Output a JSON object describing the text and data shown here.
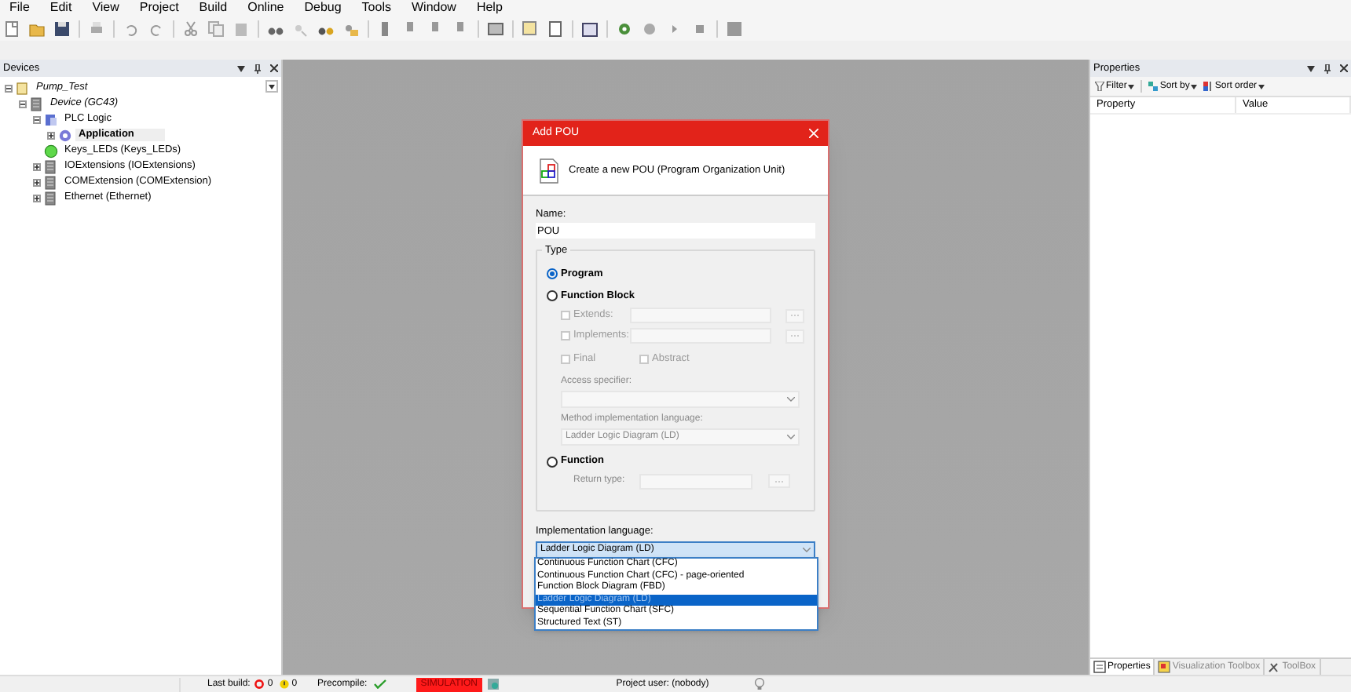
{
  "menu": [
    "File",
    "Edit",
    "View",
    "Project",
    "Build",
    "Online",
    "Debug",
    "Tools",
    "Window",
    "Help"
  ],
  "devices": {
    "title": "Devices",
    "tree": [
      {
        "label": "Pump_Test",
        "kind": "project",
        "italic": true,
        "expanded": true,
        "selected": false,
        "children": [
          {
            "label": "Device (GC43)",
            "kind": "device",
            "italic": true,
            "expanded": true,
            "selected": false,
            "children": [
              {
                "label": "PLC Logic",
                "kind": "plc",
                "italic": false,
                "expanded": true,
                "selected": false,
                "children": [
                  {
                    "label": "Application",
                    "kind": "app",
                    "italic": false,
                    "expanded": false,
                    "selected": true
                  }
                ]
              },
              {
                "label": "Keys_LEDs (Keys_LEDs)",
                "kind": "led",
                "italic": false,
                "selected": false
              },
              {
                "label": "IOExtensions (IOExtensions)",
                "kind": "device",
                "italic": false,
                "expanded": false,
                "selected": false
              },
              {
                "label": "COMExtension (COMExtension)",
                "kind": "device",
                "italic": false,
                "expanded": false,
                "selected": false
              },
              {
                "label": "Ethernet (Ethernet)",
                "kind": "device",
                "italic": false,
                "expanded": false,
                "selected": false
              }
            ]
          }
        ]
      }
    ]
  },
  "dialog": {
    "title": "Add POU",
    "header": "Create a new POU (Program Organization Unit)",
    "name_label": "Name:",
    "name_value": "POU",
    "type_label": "Type",
    "program": {
      "label": "Program",
      "selected": true
    },
    "function_block": {
      "label": "Function Block",
      "selected": false,
      "extends": {
        "label": "Extends:",
        "checked": false,
        "disabled": true
      },
      "implements": {
        "label": "Implements:",
        "checked": false,
        "disabled": true
      },
      "final": {
        "label": "Final",
        "checked": false,
        "disabled": true
      },
      "abstract": {
        "label": "Abstract",
        "checked": false,
        "disabled": true
      },
      "access_label": "Access specifier:",
      "method_label": "Method implementation language:",
      "method_value": "Ladder Logic Diagram (LD)"
    },
    "function": {
      "label": "Function",
      "selected": false,
      "return_label": "Return type:"
    },
    "impl_label": "Implementation language:",
    "impl_value": "Ladder Logic Diagram (LD)",
    "impl_options": [
      {
        "label": "Continuous Function Chart (CFC)",
        "selected": false
      },
      {
        "label": "Continuous Function Chart (CFC) - page-oriented",
        "selected": false
      },
      {
        "label": "Function Block Diagram (FBD)",
        "selected": false
      },
      {
        "label": "Ladder Logic Diagram (LD)",
        "selected": true
      },
      {
        "label": "Sequential Function Chart (SFC)",
        "selected": false
      },
      {
        "label": "Structured Text (ST)",
        "selected": false
      }
    ]
  },
  "properties": {
    "title": "Properties",
    "filter": "Filter",
    "sort_by": "Sort by",
    "sort_order": "Sort order",
    "columns": [
      "Property",
      "Value"
    ],
    "tabs": [
      {
        "label": "Properties",
        "selected": true
      },
      {
        "label": "Visualization Toolbox",
        "selected": false
      },
      {
        "label": "ToolBox",
        "selected": false
      }
    ]
  },
  "status_bar": {
    "last_build": "Last build:",
    "errors": "0",
    "warnings": "0",
    "precompile": "Precompile:",
    "simulation": "SIMULATION",
    "user": "Project user: (nobody)"
  }
}
